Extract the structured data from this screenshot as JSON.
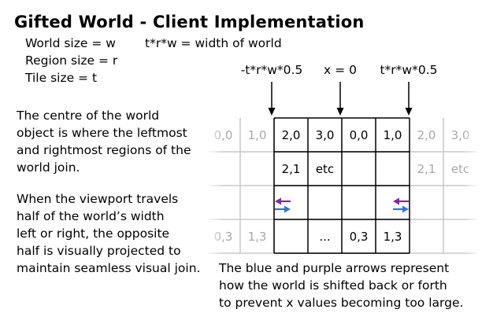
{
  "title": "Gifted World - Client Implementation",
  "definitions": [
    "World size = w",
    "Region size = r",
    "Tile size = t"
  ],
  "formula": "t*r*w = width of world",
  "markers": [
    "-t*r*w*0.5",
    "x = 0",
    "t*r*w*0.5"
  ],
  "left_text": {
    "paragraph1": [
      "The centre of the world",
      "object is where the leftmost",
      "and rightmost regions of the",
      "world join."
    ],
    "paragraph2": [
      "When the viewport travels",
      "half of the world’s width",
      "left or right, the opposite",
      "half is visually projected to",
      "maintain seamless visual join."
    ]
  },
  "bottom_text": [
    "The blue and purple arrows represent",
    "how the world is shifted back or forth",
    "to prevent x values becoming too large."
  ],
  "grid": {
    "rows": [
      [
        "0,0",
        "1,0",
        "2,0",
        "3,0",
        "0,0",
        "1,0",
        "2,0",
        "3,0"
      ],
      [
        "",
        "",
        "2,1",
        "etc",
        "",
        "",
        "2,1",
        "etc"
      ],
      [
        "",
        "",
        "",
        "",
        "",
        "",
        "",
        ""
      ],
      [
        "0,3",
        "1,3",
        "",
        "...",
        "0,3",
        "1,3",
        "",
        ""
      ]
    ],
    "faded_columns": [
      0,
      1,
      6,
      7
    ]
  },
  "colors": {
    "solid_line": "#000000",
    "faded_line": "#c8c8c8",
    "faded_text": "#a8a8a8",
    "blue_arrow": "#3a6fd8",
    "purple_arrow": "#7a2e9c"
  }
}
